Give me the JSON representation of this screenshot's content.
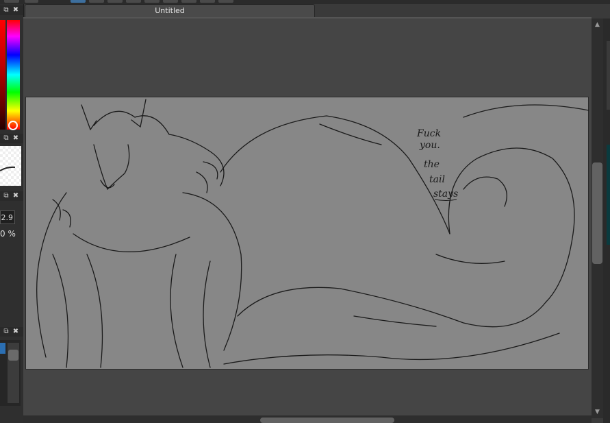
{
  "document": {
    "tab_title": "Untitled"
  },
  "left_panel": {
    "brush_size_value": "2.9",
    "opacity_value": "0 %"
  },
  "canvas": {
    "handwritten_note": [
      "Fuck",
      "you.",
      "the",
      "tail",
      "stays"
    ]
  },
  "colors": {
    "canvas_bg": "#878787",
    "workspace_bg": "#454545",
    "selected_layer": "#2b6fb3"
  },
  "icons": {
    "panel_float": "float-icon",
    "panel_close": "close-icon"
  }
}
